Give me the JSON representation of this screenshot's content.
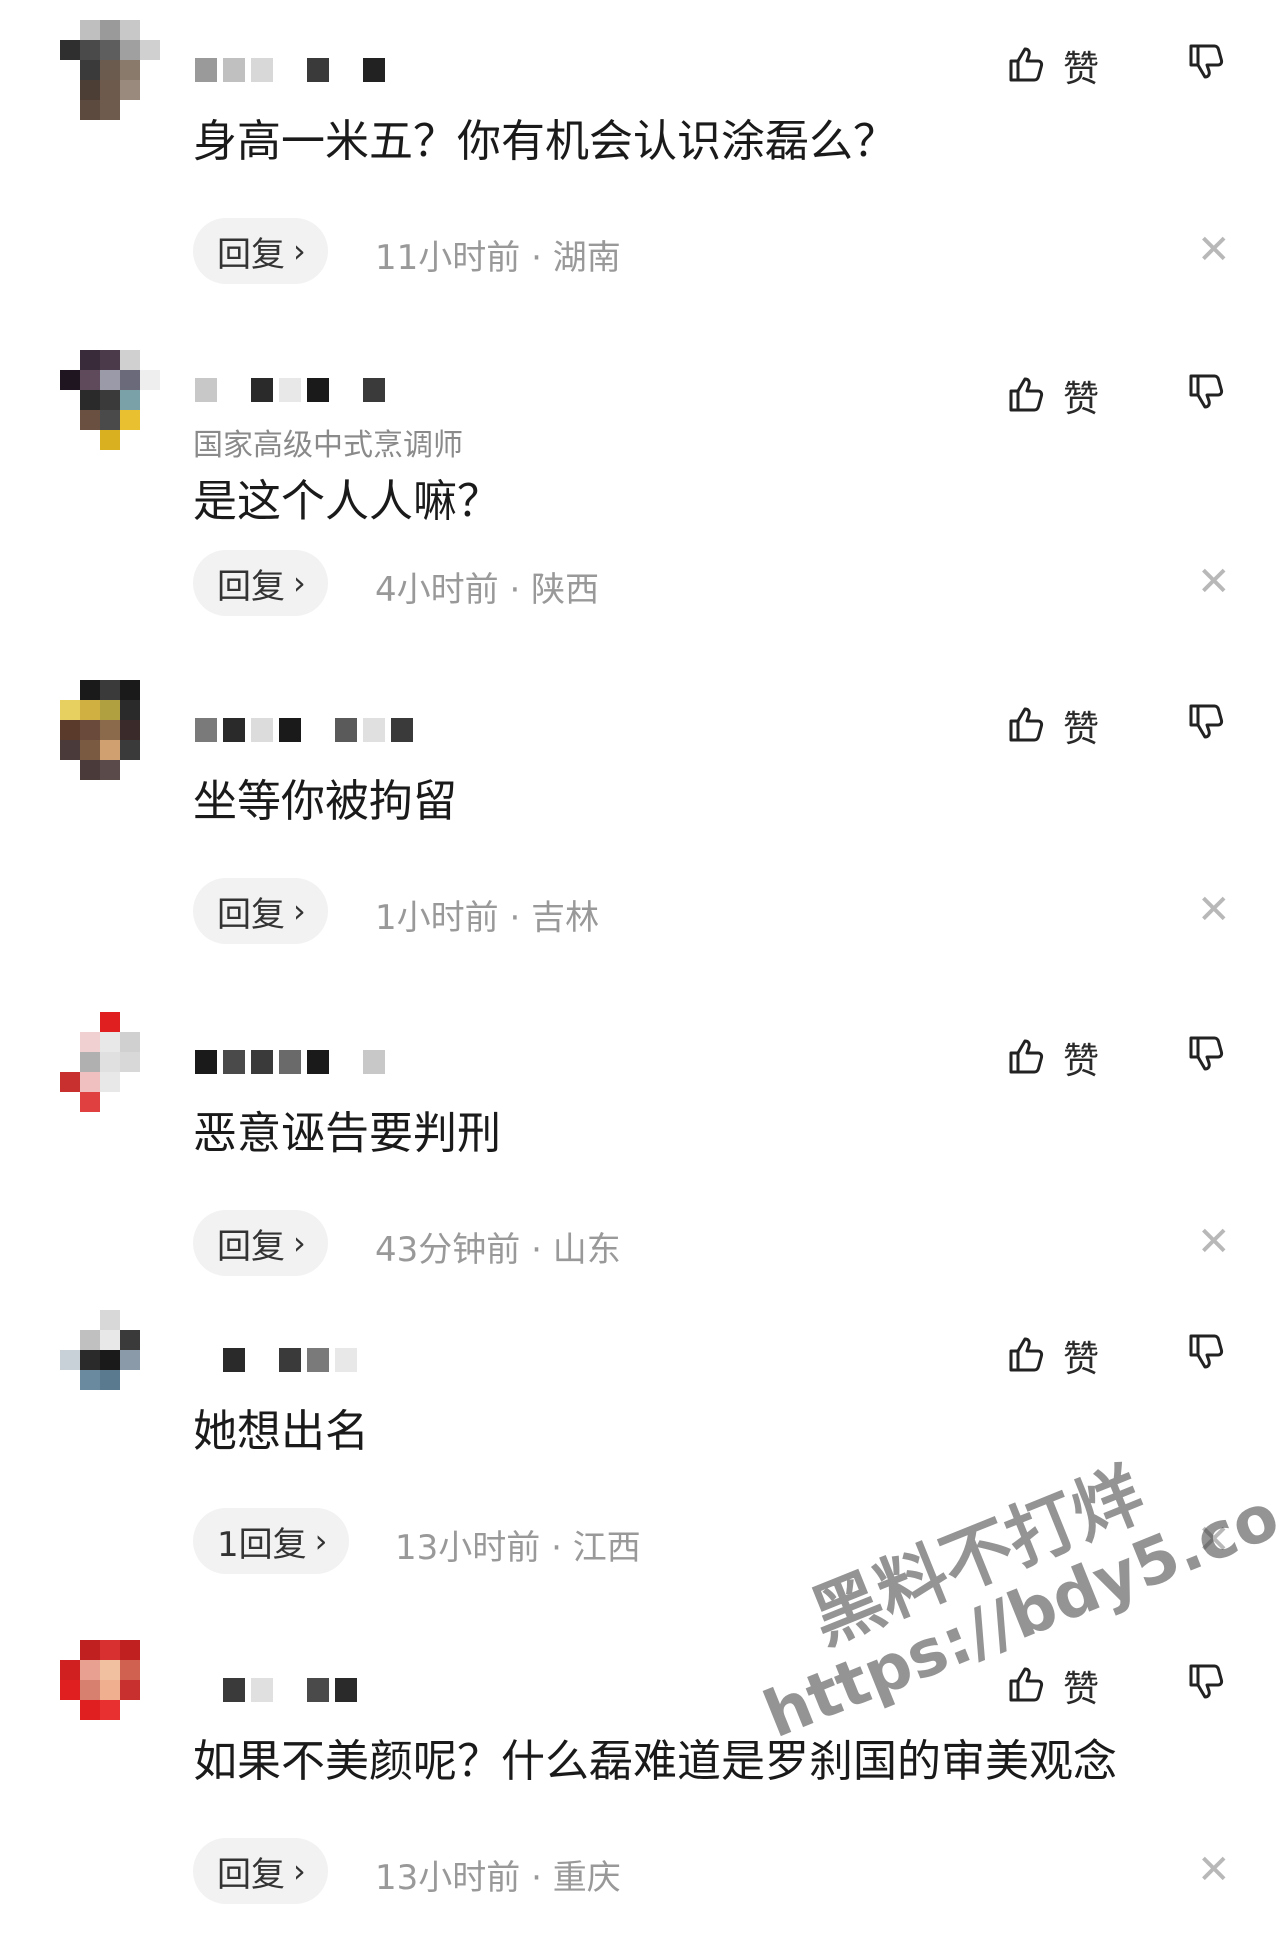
{
  "comments": [
    {
      "avatar_colors": [
        "#fff",
        "#bfbfbf",
        "#9a9a9a",
        "#c8c8c8",
        "#fff",
        "#2f2f2f",
        "#4a4a4a",
        "#5e5e5e",
        "#a0a0a0",
        "#d0d0d0",
        "#fff",
        "#3a3a3a",
        "#6b5a4e",
        "#8a7a6c",
        "#fff",
        "#fff",
        "#4d3e35",
        "#6d5a4d",
        "#9a8a7e",
        "#fff",
        "#fff",
        "#5c4a3f",
        "#6e5b4e",
        "#fff",
        "#fff"
      ],
      "username_blocks": [
        "#9a9a9a",
        "#c0c0c0",
        "#d8d8d8",
        "#fff",
        "#3a3a3a",
        "#fff",
        "#222"
      ],
      "badge": "",
      "text": "身高一米五？你有机会认识涂磊么？",
      "reply_label": "回复",
      "time": "11小时前",
      "location": "湖南",
      "like_label": "赞"
    },
    {
      "avatar_colors": [
        "#fff",
        "#3a2b3a",
        "#4a3a4a",
        "#d0d0d0",
        "#fff",
        "#1e1520",
        "#5e4a5a",
        "#9a9aa8",
        "#6a6a7a",
        "#eee",
        "#fff",
        "#2a2a2a",
        "#3a3a3a",
        "#7aa0a8",
        "#fff",
        "#fff",
        "#6a5040",
        "#4a4a4a",
        "#e8c030",
        "#fff",
        "#fff",
        "#fff",
        "#d8b020",
        "#fff",
        "#fff"
      ],
      "username_blocks": [
        "#c8c8c8",
        "#fff",
        "#2a2a2a",
        "#e8e8e8",
        "#1a1a1a",
        "#fff",
        "#3a3a3a"
      ],
      "badge": "国家高级中式烹调师",
      "text": "是这个人人嘛？",
      "reply_label": "回复",
      "time": "4小时前",
      "location": "陕西",
      "like_label": "赞"
    },
    {
      "avatar_colors": [
        "#fff",
        "#1a1a1a",
        "#3a3a3a",
        "#1a1a1a",
        "#fff",
        "#e8d060",
        "#d0b040",
        "#b0a040",
        "#2a2a2a",
        "#fff",
        "#5a3a2a",
        "#6a4a3a",
        "#8a6a4a",
        "#3a2a2a",
        "#fff",
        "#4a3a3a",
        "#7a5a40",
        "#d0a070",
        "#3a3a3a",
        "#fff",
        "#fff",
        "#4a3a3a",
        "#5a4a4a",
        "#fff",
        "#fff"
      ],
      "username_blocks": [
        "#7a7a7a",
        "#2a2a2a",
        "#dcdcdc",
        "#1a1a1a",
        "#fff",
        "#5a5a5a",
        "#e0e0e0",
        "#3a3a3a"
      ],
      "badge": "",
      "text": "坐等你被拘留",
      "reply_label": "回复",
      "time": "1小时前",
      "location": "吉林",
      "like_label": "赞"
    },
    {
      "avatar_colors": [
        "#fff",
        "#fff",
        "#e02020",
        "#fff",
        "#fff",
        "#fff",
        "#f0d0d0",
        "#e8e8e8",
        "#d0d0d0",
        "#fff",
        "#fff",
        "#b0b0b0",
        "#e0e0e0",
        "#d8d8d8",
        "#fff",
        "#c83030",
        "#f0c0c0",
        "#e8e8e8",
        "#fff",
        "#fff",
        "#fff",
        "#e04040",
        "#fff",
        "#fff",
        "#fff"
      ],
      "username_blocks": [
        "#1a1a1a",
        "#4a4a4a",
        "#3a3a3a",
        "#6a6a6a",
        "#1a1a1a",
        "#fff",
        "#c8c8c8"
      ],
      "badge": "",
      "text": "恶意诬告要判刑",
      "reply_label": "回复",
      "time": "43分钟前",
      "location": "山东",
      "like_label": "赞"
    },
    {
      "avatar_colors": [
        "#fff",
        "#fff",
        "#d8d8d8",
        "#fff",
        "#fff",
        "#fff",
        "#c0c0c0",
        "#e8e8e8",
        "#3a3a3a",
        "#fff",
        "#c8d0d8",
        "#2a2a2a",
        "#1a1a1a",
        "#8a9aa8",
        "#fff",
        "#fff",
        "#6a8aa0",
        "#5a7a90",
        "#fff",
        "#fff",
        "#fff",
        "#fff",
        "#fff",
        "#fff",
        "#fff"
      ],
      "username_blocks": [
        "#fff",
        "#2a2a2a",
        "#fff",
        "#3a3a3a",
        "#7a7a7a",
        "#e8e8e8"
      ],
      "badge": "",
      "text": "她想出名",
      "reply_label": "1回复",
      "time": "13小时前",
      "location": "江西",
      "like_label": "赞"
    },
    {
      "avatar_colors": [
        "#fff",
        "#c02020",
        "#d83030",
        "#c02020",
        "#fff",
        "#d02020",
        "#e8a090",
        "#f0c0a0",
        "#d06050",
        "#fff",
        "#e02020",
        "#d88070",
        "#f0b090",
        "#c83030",
        "#fff",
        "#fff",
        "#e02020",
        "#e83030",
        "#fff",
        "#fff",
        "#fff",
        "#fff",
        "#fff",
        "#fff",
        "#fff"
      ],
      "username_blocks": [
        "#fff",
        "#3a3a3a",
        "#e0e0e0",
        "#fff",
        "#4a4a4a",
        "#2a2a2a"
      ],
      "badge": "",
      "text": "如果不美颜呢？什么磊难道是罗刹国的审美观念",
      "reply_label": "回复",
      "time": "13小时前",
      "location": "重庆",
      "like_label": "赞"
    }
  ],
  "separator_dot": "·",
  "watermark": {
    "line1": "黑料不打烊",
    "line2": "https://bdy5.co"
  }
}
